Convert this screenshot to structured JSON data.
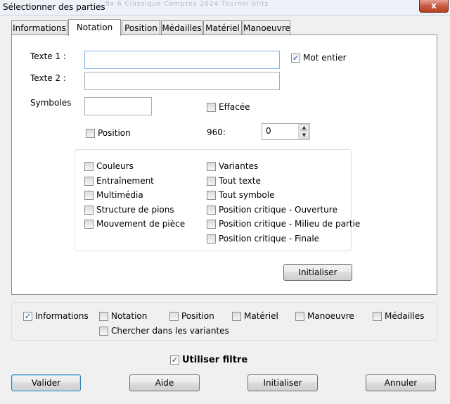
{
  "window": {
    "title": "Sélectionner des parties",
    "close": "x"
  },
  "background_ghost": "9x 6 Classique Comptes 2024 Tournoi blitz",
  "tabs": [
    "Informations",
    "Notation",
    "Position",
    "Médailles",
    "Matériel",
    "Manoeuvre"
  ],
  "active_tab": "Notation",
  "notation": {
    "texte1_label": "Texte 1 :",
    "texte2_label": "Texte 2 :",
    "texte1_value": "",
    "texte2_value": "",
    "mot_entier": {
      "label": "Mot entier",
      "checked": true
    },
    "symboles_label": "Symboles",
    "symboles_value": "",
    "effacee": {
      "label": "Effacée",
      "checked": false
    },
    "position": {
      "label": "Position",
      "checked": false
    },
    "counter_label": "960:",
    "counter_value": "0",
    "options_left": [
      {
        "label": "Couleurs",
        "checked": false
      },
      {
        "label": "Entraînement",
        "checked": false
      },
      {
        "label": "Multimédia",
        "checked": false
      },
      {
        "label": "Structure de pions",
        "checked": false
      },
      {
        "label": "Mouvement de pièce",
        "checked": false
      }
    ],
    "options_right": [
      {
        "label": "Variantes",
        "checked": false
      },
      {
        "label": "Tout texte",
        "checked": false
      },
      {
        "label": "Tout symbole",
        "checked": false
      },
      {
        "label": "Position critique - Ouverture",
        "checked": false
      },
      {
        "label": "Position critique - Milieu de partie",
        "checked": false
      },
      {
        "label": "Position critique - Finale",
        "checked": false
      }
    ],
    "reset_label": "Initialiser"
  },
  "filters": [
    {
      "label": "Informations",
      "checked": true
    },
    {
      "label": "Notation",
      "checked": false
    },
    {
      "label": "Position",
      "checked": false
    },
    {
      "label": "Matériel",
      "checked": false
    },
    {
      "label": "Manoeuvre",
      "checked": false
    },
    {
      "label": "Médailles",
      "checked": false
    }
  ],
  "search_variants": {
    "label": "Chercher dans les variantes",
    "checked": false
  },
  "use_filter": {
    "label": "Utiliser filtre",
    "checked": true
  },
  "buttons": {
    "validate": "Valider",
    "help": "Aide",
    "reset": "Initialiser",
    "cancel": "Annuler"
  },
  "check_glyph": "✓"
}
